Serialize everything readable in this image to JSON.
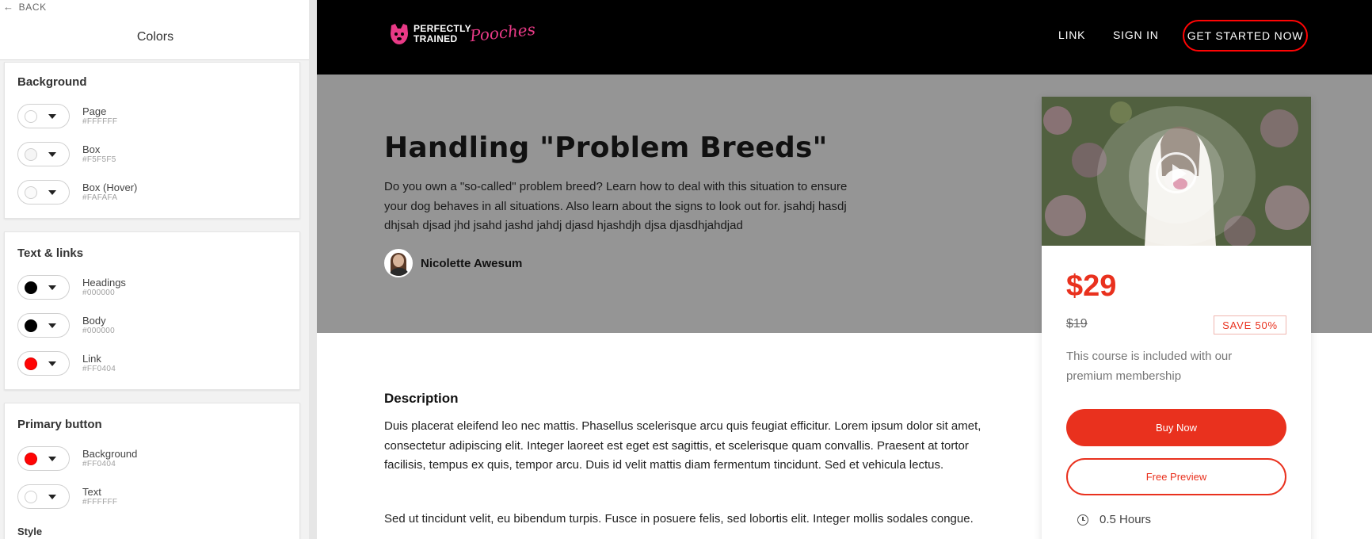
{
  "editor": {
    "back_label": "BACK",
    "title": "Colors",
    "sections": [
      {
        "title": "Background",
        "items": [
          {
            "name": "Page",
            "hex": "#FFFFFF",
            "color": "#FFFFFF"
          },
          {
            "name": "Box",
            "hex": "#F5F5F5",
            "color": "#F5F5F5"
          },
          {
            "name": "Box (Hover)",
            "hex": "#FAFAFA",
            "color": "#FAFAFA"
          }
        ]
      },
      {
        "title": "Text & links",
        "items": [
          {
            "name": "Headings",
            "hex": "#000000",
            "color": "#000000"
          },
          {
            "name": "Body",
            "hex": "#000000",
            "color": "#000000"
          },
          {
            "name": "Link",
            "hex": "#FF0404",
            "color": "#FF0404"
          }
        ]
      },
      {
        "title": "Primary button",
        "items": [
          {
            "name": "Background",
            "hex": "#FF0404",
            "color": "#FF0404"
          },
          {
            "name": "Text",
            "hex": "#FFFFFF",
            "color": "#FFFFFF"
          }
        ],
        "next_label": "Style"
      }
    ]
  },
  "site": {
    "logo_line1": "PERFECTLY",
    "logo_line2": "TRAINED",
    "logo_script": "Pooches",
    "nav": {
      "link": "LINK",
      "sign_in": "SIGN IN",
      "cta": "GET STARTED NOW"
    },
    "hero": {
      "title": "Handling \"Problem Breeds\"",
      "description": "Do you own a \"so-called\" problem breed? Learn how to deal with this situation to ensure your dog behaves in all situations. Also learn about the signs to look out for. jsahdj hasdj dhjsah djsad jhd jsahd jashd jahdj djasd hjashdjh djsa djasdhjahdjad",
      "author": "Nicolette Awesum"
    },
    "pricing": {
      "price": "$29",
      "old_price": "$19",
      "save": "SAVE 50%",
      "note": "This course is included with our premium membership",
      "buy": "Buy Now",
      "preview": "Free Preview",
      "duration": "0.5 Hours"
    },
    "description": {
      "title": "Description",
      "p1": "Duis placerat eleifend leo nec mattis. Phasellus scelerisque arcu quis feugiat efficitur. Lorem ipsum dolor sit amet, consectetur adipiscing elit. Integer laoreet est eget est sagittis, et scelerisque quam convallis. Praesent at tortor facilisis, tempus ex quis, tempor arcu. Duis id velit mattis diam fermentum tincidunt. Sed et vehicula lectus.",
      "p2": "Sed ut tincidunt velit, eu bibendum turpis. Fusce in posuere felis, sed lobortis elit. Integer mollis sodales congue."
    },
    "colors": {
      "accent": "#E9311E",
      "link_color": "#FF0404",
      "hero_bg": "#959595",
      "nav_bg": "#000000",
      "logo_pink": "#E83A86"
    }
  }
}
